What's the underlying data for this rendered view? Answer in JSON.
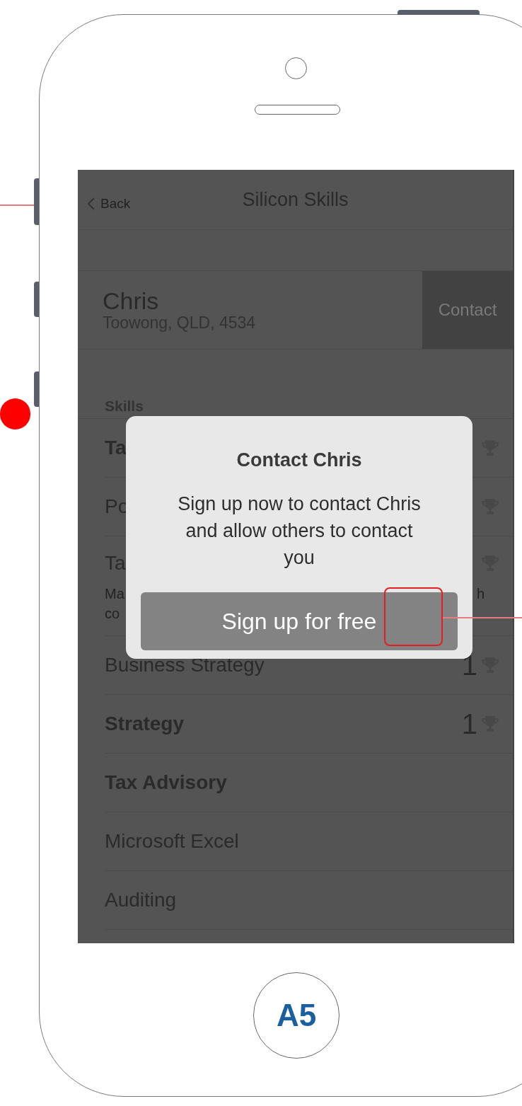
{
  "nav": {
    "back": "Back",
    "title": "Silicon Skills"
  },
  "profile": {
    "name": "Chris",
    "location": "Toowong, QLD, 4534",
    "contact": "Contact"
  },
  "skills_header": "Skills",
  "skills": [
    {
      "label": "Ta",
      "bold": true,
      "trophy": true
    },
    {
      "label": "Po",
      "bold": false,
      "trophy": true
    },
    {
      "label": "Ta",
      "bold": false,
      "trophy": true,
      "description": [
        "Ma",
        "co"
      ],
      "description_tail": "h"
    },
    {
      "label": "Business Strategy",
      "bold": false,
      "count": "1",
      "trophy": true
    },
    {
      "label": "Strategy",
      "bold": true,
      "count": "1",
      "trophy": true
    },
    {
      "label": "Tax Advisory",
      "bold": true,
      "trophy": false
    },
    {
      "label": "Microsoft Excel",
      "bold": false,
      "trophy": false
    },
    {
      "label": "Auditing",
      "bold": false,
      "trophy": false
    }
  ],
  "dialog": {
    "title": "Contact Chris",
    "message": "Sign up now to contact Chris and allow others to contact you",
    "button": "Sign up for free"
  },
  "home_button": "A5"
}
